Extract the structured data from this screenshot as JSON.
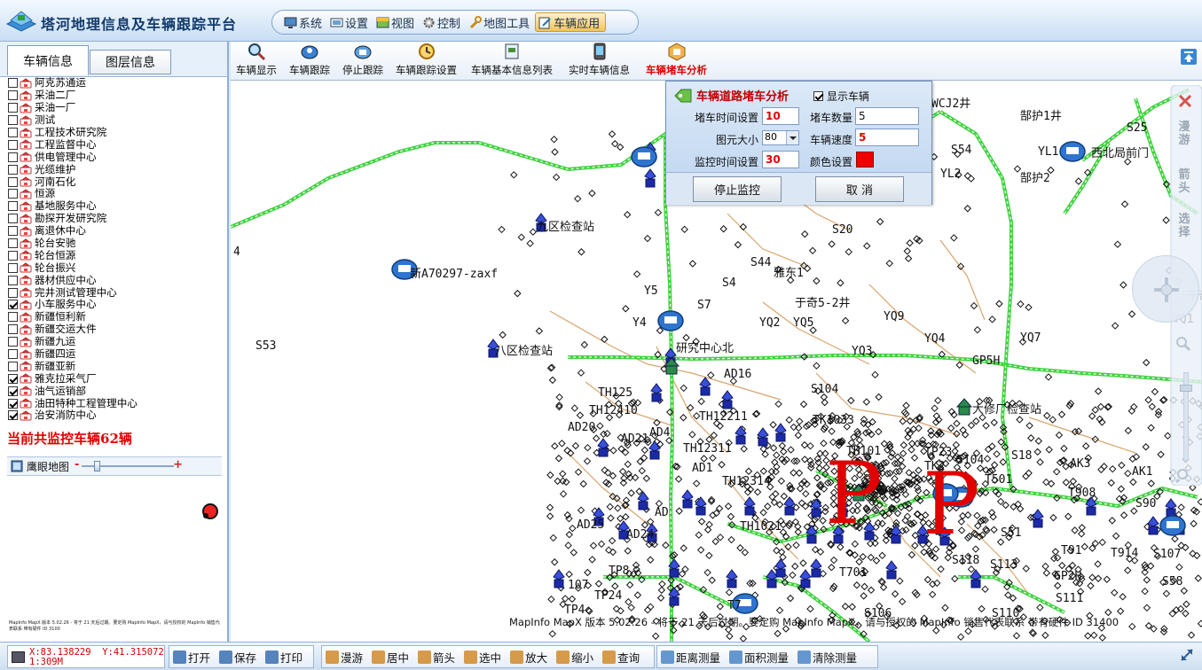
{
  "app": {
    "title": "塔河地理信息及车辆跟踪平台"
  },
  "menu": [
    {
      "label": "系统",
      "icon": "system-icon"
    },
    {
      "label": "设置",
      "icon": "settings-icon"
    },
    {
      "label": "视图",
      "icon": "view-icon"
    },
    {
      "label": "控制",
      "icon": "gear-icon"
    },
    {
      "label": "地图工具",
      "icon": "wrench-icon"
    },
    {
      "label": "车辆应用",
      "icon": "edit-icon",
      "active": true
    }
  ],
  "left": {
    "tab_vehicles": "车辆信息",
    "tab_layers": "图层信息",
    "groups": [
      {
        "name": "阿克苏通运",
        "checked": false
      },
      {
        "name": "采油二厂",
        "checked": false
      },
      {
        "name": "采油一厂",
        "checked": false
      },
      {
        "name": "测试",
        "checked": false
      },
      {
        "name": "工程技术研究院",
        "checked": false
      },
      {
        "name": "工程监督中心",
        "checked": false
      },
      {
        "name": "供电管理中心",
        "checked": false
      },
      {
        "name": "光缆维护",
        "checked": false
      },
      {
        "name": "河南石化",
        "checked": false
      },
      {
        "name": "恒源",
        "checked": false
      },
      {
        "name": "基地服务中心",
        "checked": false
      },
      {
        "name": "勘探开发研究院",
        "checked": false
      },
      {
        "name": "离退休中心",
        "checked": false
      },
      {
        "name": "轮台安驰",
        "checked": false
      },
      {
        "name": "轮台恒源",
        "checked": false
      },
      {
        "name": "轮台振兴",
        "checked": false
      },
      {
        "name": "器材供应中心",
        "checked": false
      },
      {
        "name": "完井测试管理中心",
        "checked": false
      },
      {
        "name": "小车服务中心",
        "checked": true
      },
      {
        "name": "新疆恒利新",
        "checked": false
      },
      {
        "name": "新疆交运大件",
        "checked": false
      },
      {
        "name": "新疆九运",
        "checked": false
      },
      {
        "name": "新疆四运",
        "checked": false
      },
      {
        "name": "新疆亚新",
        "checked": false
      },
      {
        "name": "雅克拉采气厂",
        "checked": true
      },
      {
        "name": "油气运销部",
        "checked": true
      },
      {
        "name": "油田特种工程管理中心",
        "checked": true
      },
      {
        "name": "治安消防中心",
        "checked": true
      }
    ],
    "summary": "当前共监控车辆62辆",
    "eagle_label": "鹰眼地图",
    "eagle_copyright": "MapInfo MapX 版本 5.02.26 - 将于 21 天后过期。要定购 MapInfo MapX，请与授权的 MapInfo 销售代表联系 带有硬件 ID 3100"
  },
  "toolbar": [
    {
      "label": "车辆显示",
      "icon": "vehicle-show-icon"
    },
    {
      "label": "车辆跟踪",
      "icon": "vehicle-track-icon"
    },
    {
      "label": "停止跟踪",
      "icon": "stop-track-icon"
    },
    {
      "label": "车辆跟踪设置",
      "icon": "track-settings-icon"
    },
    {
      "label": "车辆基本信息列表",
      "icon": "vehicle-list-icon"
    },
    {
      "label": "实时车辆信息",
      "icon": "realtime-info-icon"
    },
    {
      "label": "车辆堵车分析",
      "icon": "jam-analysis-icon",
      "active": true
    }
  ],
  "dialog": {
    "title": "车辆道路堵车分析",
    "show_vehicles_label": "显示车辆",
    "show_vehicles_checked": true,
    "jam_time_label": "堵车时间设置",
    "jam_time_value": "10",
    "jam_count_label": "堵车数量",
    "jam_count_value": "5",
    "icon_size_label": "图元大小",
    "icon_size_value": "80",
    "speed_label": "车辆速度",
    "speed_value": "5",
    "monitor_time_label": "监控时间设置",
    "monitor_time_value": "30",
    "color_label": "颜色设置",
    "color_value": "#ee0000",
    "stop_button": "停止监控",
    "cancel_button": "取  消"
  },
  "right_controls": {
    "close": "close-icon",
    "pan_label": "漫游",
    "arrow_label": "箭头",
    "select_label": "选择"
  },
  "map": {
    "labels": [
      "4",
      "S53",
      "WCJ2井",
      "S54",
      "YL2",
      "郜护1井",
      "郜护2",
      "YL1",
      "S25",
      "西北局前门",
      "九区检查站",
      "新A70297-zaxf",
      "S20",
      "S44",
      "雅东1",
      "S4",
      "Y5",
      "于奇5-2井",
      "Y4",
      "S7",
      "YQ2",
      "YQ5",
      "YQ9",
      "YQ4",
      "YQ7",
      "YQ3",
      "八区检查站",
      "研究中心北",
      "GP5H",
      "AD16",
      "S104",
      "TH125",
      "TH12410",
      "TH12211",
      "TK1033",
      "大修厂检查站",
      "AD20",
      "AD21",
      "AD4",
      "TH12311",
      "TH101",
      "TP23",
      "S104",
      "S18",
      "AK3",
      "AK1",
      "TH12314",
      "AD1",
      "T501",
      "TK2",
      "T908",
      "S90",
      "AD25",
      "AD24",
      "TH1021",
      "S51",
      "T91",
      "T914",
      "S107",
      "AD",
      "107",
      "TP8",
      "TP24",
      "T701",
      "S113",
      "S118",
      "GP2H",
      "TP4",
      "T7",
      "S106",
      "S110",
      "S111",
      "S58",
      "YQ1",
      "于奇",
      "P",
      "P"
    ],
    "copyright": "MapInfo MapX 版本 5.02.26 - 将于 21 天后过期。要定购 MapInfo MapX，请与授权的 MapInfo 销售代表联系 带有硬件 ID 31400"
  },
  "status": {
    "x_label": "X:83.138229",
    "y_label": "Y:41.315072",
    "scale": "1:309M",
    "buttons_file": [
      {
        "label": "打开",
        "icon": "open-icon"
      },
      {
        "label": "保存",
        "icon": "save-icon"
      },
      {
        "label": "打印",
        "icon": "print-icon"
      }
    ],
    "buttons_nav": [
      {
        "label": "漫游",
        "icon": "hand-icon"
      },
      {
        "label": "居中",
        "icon": "center-icon"
      },
      {
        "label": "箭头",
        "icon": "anchor-icon"
      },
      {
        "label": "选中",
        "icon": "pointer-icon"
      },
      {
        "label": "放大",
        "icon": "zoom-in-icon"
      },
      {
        "label": "缩小",
        "icon": "zoom-out-icon"
      },
      {
        "label": "查询",
        "icon": "query-icon"
      }
    ],
    "buttons_measure": [
      {
        "label": "距离测量",
        "icon": "ruler-icon"
      },
      {
        "label": "面积测量",
        "icon": "area-icon"
      },
      {
        "label": "清除测量",
        "icon": "clear-icon"
      }
    ]
  }
}
